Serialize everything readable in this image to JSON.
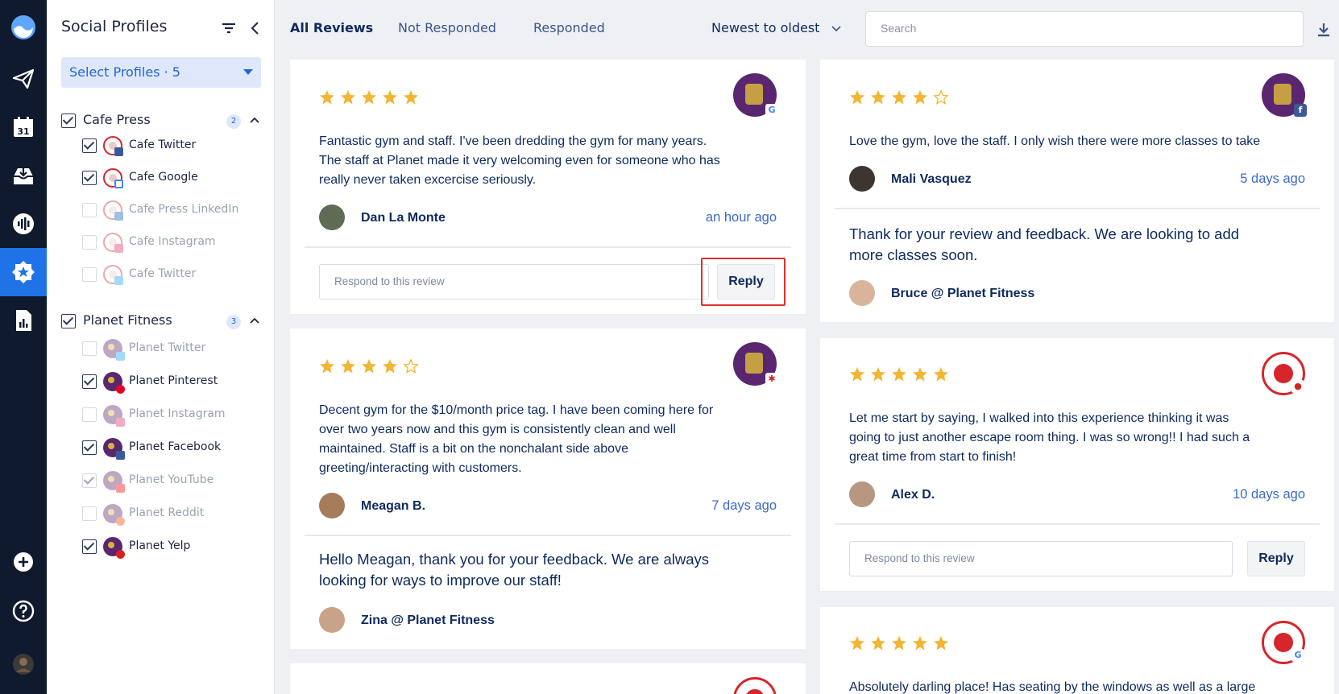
{
  "colors": {
    "rail": "#0f1a2e",
    "accent": "#1f73e6",
    "star": "#f2b634",
    "link": "#3a6bc8",
    "highlight": "#d9342b"
  },
  "rail": {
    "items": [
      {
        "icon": "logo-icon"
      },
      {
        "icon": "paper-plane-icon"
      },
      {
        "icon": "calendar-icon",
        "label": "31"
      },
      {
        "icon": "inbox-icon"
      },
      {
        "icon": "listening-icon"
      },
      {
        "icon": "star-badge-icon",
        "active": true
      },
      {
        "icon": "report-icon"
      },
      {
        "icon": "add-icon"
      },
      {
        "icon": "help-icon"
      },
      {
        "icon": "user-avatar"
      }
    ]
  },
  "sidebar": {
    "title": "Social Profiles",
    "select_label": "Select Profiles · 5",
    "groups": [
      {
        "name": "Cafe Press",
        "count": "2",
        "profiles": [
          {
            "label": "Cafe Twitter",
            "checked": true,
            "network": "facebook"
          },
          {
            "label": "Cafe Google",
            "checked": true,
            "network": "google"
          },
          {
            "label": "Cafe Press LinkedIn",
            "checked": false,
            "network": "linkedin"
          },
          {
            "label": "Cafe Instagram",
            "checked": false,
            "network": "instagram"
          },
          {
            "label": "Cafe Twitter",
            "checked": false,
            "network": "twitter"
          }
        ]
      },
      {
        "name": "Planet Fitness",
        "count": "3",
        "profiles": [
          {
            "label": "Planet Twitter",
            "checked": false,
            "network": "twitter"
          },
          {
            "label": "Planet Pinterest",
            "checked": true,
            "network": "pinterest"
          },
          {
            "label": "Planet Instagram",
            "checked": false,
            "network": "instagram"
          },
          {
            "label": "Planet Facebook",
            "checked": true,
            "network": "facebook"
          },
          {
            "label": "Planet YouTube",
            "checked": true,
            "network": "youtube",
            "disabled": true
          },
          {
            "label": "Planet Reddit",
            "checked": false,
            "network": "reddit"
          },
          {
            "label": "Planet Yelp",
            "checked": true,
            "network": "yelp"
          }
        ]
      }
    ]
  },
  "tabs": [
    "All Reviews",
    "Not Responded",
    "Responded"
  ],
  "sort_label": "Newest to oldest",
  "search": {
    "placeholder": "Search"
  },
  "reviews": [
    {
      "stars": 5,
      "network": "google",
      "brand": "planet",
      "text": [
        "Fantastic gym and staff. I've been dredding the gym for many years.",
        "The staff at Planet made it very welcoming even for someone who has",
        "really never taken excercise seriously."
      ],
      "author": "Dan La Monte",
      "time": "an hour ago",
      "respond_placeholder": "Respond to this review",
      "reply_label": "Reply"
    },
    {
      "stars": 4,
      "network": "yelp",
      "brand": "planet",
      "text": [
        "Decent gym for the $10/month price tag. I have been coming here for",
        "over two years now and this gym is consistently clean and well",
        "maintained. Staff is a bit on the nonchalant side above",
        "greeting/interacting with customers."
      ],
      "author": "Meagan B.",
      "time": "7 days ago",
      "response": [
        "Hello Meagan, thank you for your feedback. We are always",
        "looking for ways to improve our staff!"
      ],
      "responder": "Zina @ Planet Fitness"
    },
    {
      "stars": 4,
      "network": "facebook",
      "brand": "planet",
      "text": [
        "Love the gym, love the staff. I only wish there were more classes to take"
      ],
      "author": "Mali Vasquez",
      "time": "5 days ago",
      "response": [
        "Thank for your review and feedback. We are looking to add",
        "more classes soon."
      ],
      "responder": "Bruce @ Planet Fitness"
    },
    {
      "stars": 5,
      "network": "yelp",
      "brand": "cafe",
      "text": [
        "Let me start by saying, I walked into this experience thinking it was",
        "going to just another escape room thing. I was so wrong!! I had such a",
        "great time from start to finish!"
      ],
      "author": "Alex D.",
      "time": "10 days ago",
      "respond_placeholder": "Respond to this review",
      "reply_label": "Reply"
    },
    {
      "stars": 5,
      "network": "google",
      "brand": "cafe",
      "text": [
        "Absolutely darling place! Has seating by the windows as well as a large"
      ]
    }
  ]
}
